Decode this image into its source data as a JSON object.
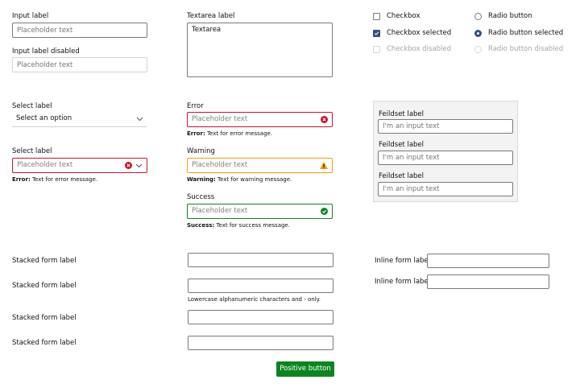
{
  "col1": {
    "input_label": "Input label",
    "input_placeholder": "Placeholder text",
    "disabled_label": "Input label disabled",
    "disabled_placeholder": "Placeholder text",
    "select_label_1": "Select label",
    "select_value_1": "Select an option",
    "select_label_2": "Select label",
    "select_value_2": "Placeholder text",
    "select_error_prefix": "Error:",
    "select_error_text": " Text for error message."
  },
  "col2": {
    "textarea_label": "Textarea label",
    "textarea_value": "Textarea",
    "error_label": "Error",
    "error_placeholder": "Placeholder text",
    "error_prefix": "Error:",
    "error_text": " Text for error message.",
    "warning_label": "Warning",
    "warning_placeholder": "Placeholder text",
    "warning_prefix": "Warning:",
    "warning_text": " Text for warning message.",
    "success_label": "Success",
    "success_placeholder": "Placeholder text",
    "success_prefix": "Success:",
    "success_text": " Text for success message."
  },
  "choices": {
    "checkbox": "Checkbox",
    "checkbox_selected": "Checkbox selected",
    "checkbox_disabled": "Checkbox disabled",
    "radio": "Radio button",
    "radio_selected": "Radio button selected",
    "radio_disabled": "Radio button disabled"
  },
  "fieldset": {
    "items": [
      {
        "label": "Feildset label",
        "placeholder": "I'm an input text"
      },
      {
        "label": "Feildset label",
        "placeholder": "I'm an input text"
      },
      {
        "label": "Feildset label",
        "placeholder": "I'm an input text"
      }
    ]
  },
  "stacked": {
    "labels": [
      "Stacked form label",
      "Stacked form label",
      "Stacked form label",
      "Stacked form label"
    ],
    "help_text": "Lowercase alphanumeric characters and - only."
  },
  "inline": {
    "labels": [
      "Inline form label",
      "Inline form label"
    ]
  },
  "button": {
    "positive_label": "Positive button"
  },
  "colors": {
    "error": "#c7162b",
    "warning": "#f99b11",
    "success": "#0e8420",
    "checked": "#335280"
  },
  "icons": {
    "error": "error-icon",
    "warning": "warning-icon",
    "success": "success-icon",
    "chevron": "chevron-down-icon"
  }
}
